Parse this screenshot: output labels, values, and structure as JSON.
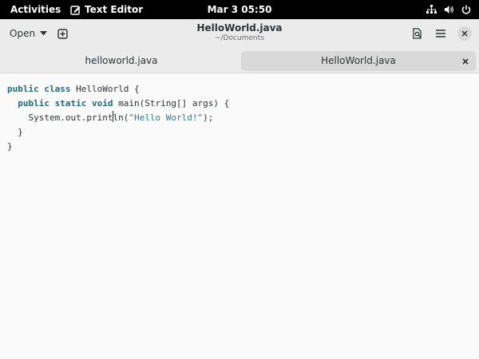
{
  "topbar": {
    "activities": "Activities",
    "app_name": "Text Editor",
    "clock": "Mar 3  05:50",
    "status_icons": [
      "network-icon",
      "volume-icon",
      "power-icon"
    ]
  },
  "headerbar": {
    "open_label": "Open",
    "title": "HelloWorld.java",
    "subtitle": "~/Documents"
  },
  "tabs": [
    {
      "label": "helloworld.java",
      "active": false
    },
    {
      "label": "HelloWorld.java",
      "active": true
    }
  ],
  "editor": {
    "lines": [
      {
        "t1": "public",
        "t2": "class",
        "t3": "HelloWorld {"
      },
      {
        "t1": "public",
        "t2": "static",
        "t3": "void",
        "t4": "main(String[] args) {"
      },
      {
        "pre_cursor": "System.out.print",
        "post_cursor": "ln(",
        "string": "\"Hello World!\"",
        "tail": ");"
      },
      {
        "text": "}"
      },
      {
        "text": "}"
      }
    ]
  },
  "colors": {
    "topbar_bg": "#000000",
    "headerbar_bg": "#ebebeb",
    "active_tab_bg": "#d9d9d9",
    "editor_bg": "#fafafa",
    "keyword": "#1d6c7b",
    "string": "#2a7f8f"
  }
}
